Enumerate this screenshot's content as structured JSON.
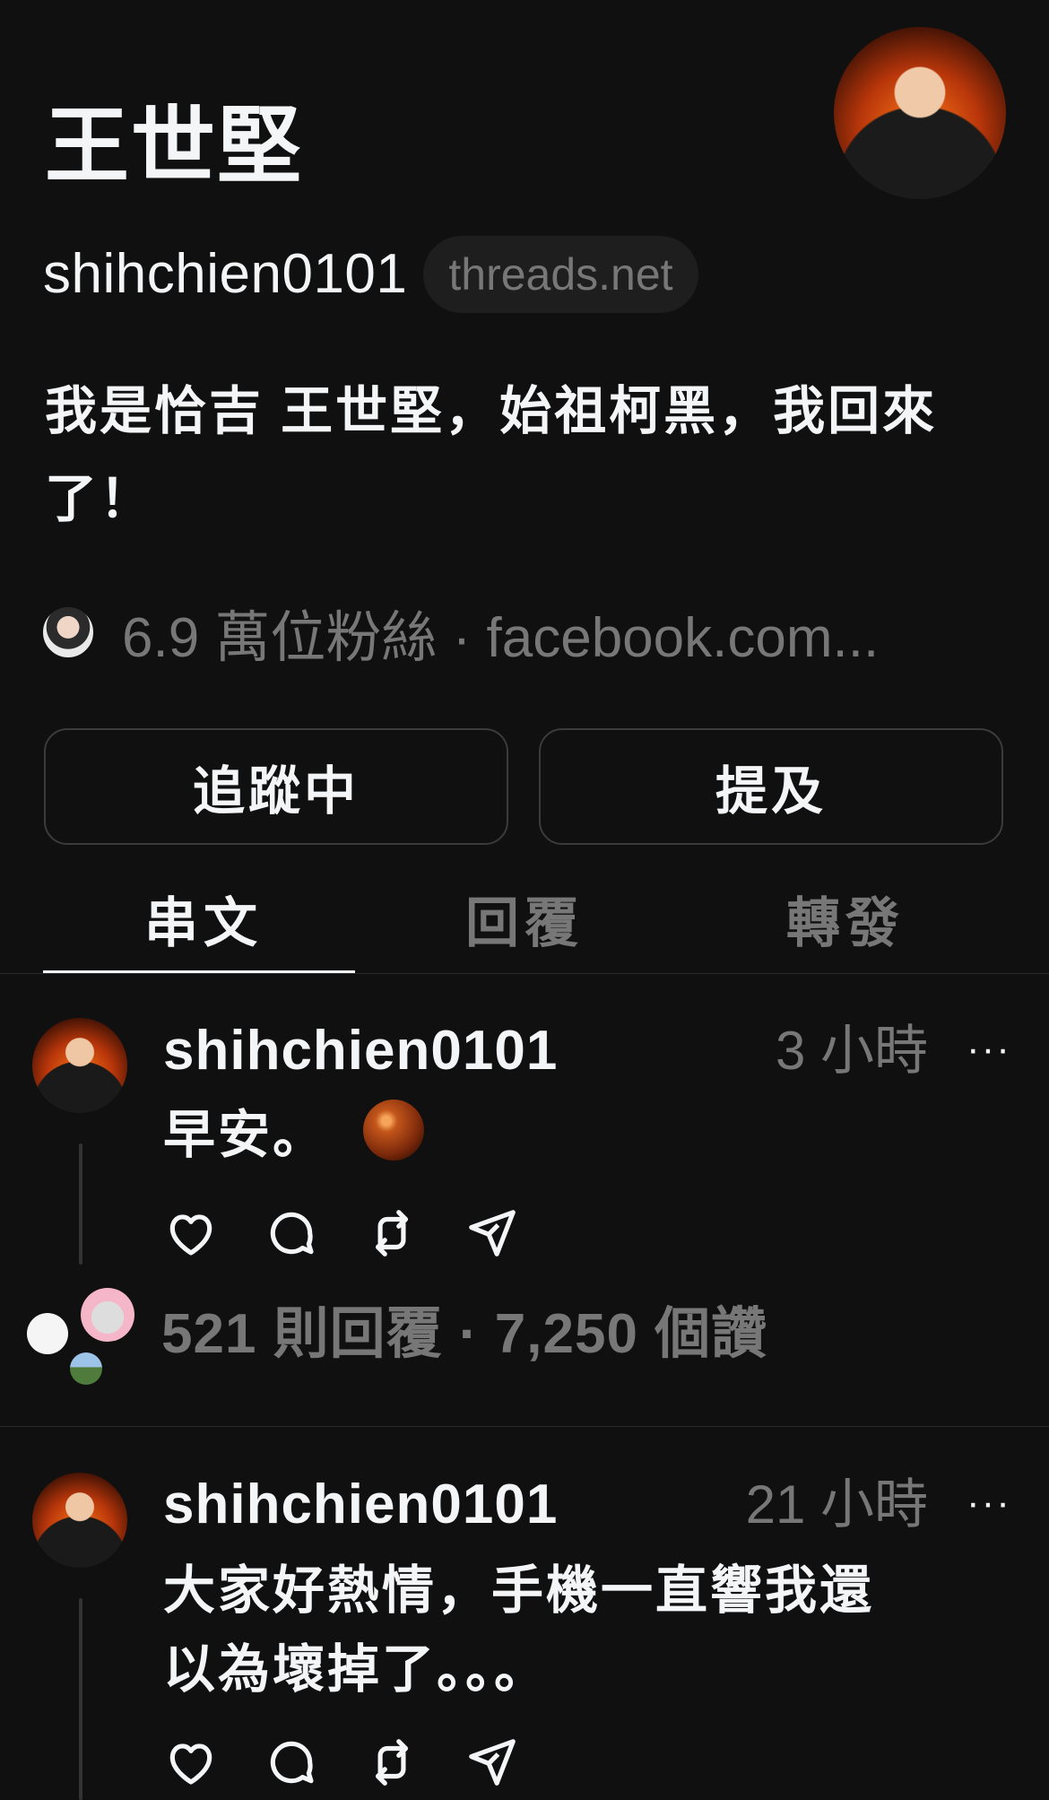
{
  "profile": {
    "display_name": "王世堅",
    "handle": "shihchien0101",
    "domain_badge": "threads.net",
    "bio": "我是恰吉 王世堅，始祖柯黑，我回來了！",
    "followers_text": "6.9 萬位粉絲 · facebook.com..."
  },
  "buttons": {
    "following": "追蹤中",
    "mention": "提及"
  },
  "tabs": [
    "串文",
    "回覆",
    "轉發"
  ],
  "posts": [
    {
      "user": "shihchien0101",
      "time": "3 小時",
      "more": "···",
      "text": "早安。",
      "emoji": "chestnut",
      "stats": "521 則回覆 · 7,250 個讚"
    },
    {
      "user": "shihchien0101",
      "time": "21 小時",
      "more": "···",
      "text_line1": "大家好熱情，手機一直響我還",
      "text_line2": "以為壞掉了。。。"
    }
  ],
  "colors": {
    "background": "#101010",
    "text": "#f3f5f7",
    "muted": "#777777"
  }
}
